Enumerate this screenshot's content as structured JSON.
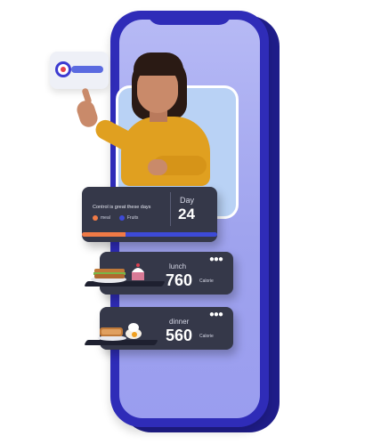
{
  "day_card": {
    "caption": "Control is great these days",
    "legend": [
      {
        "label": "meal",
        "color": "#f07a46"
      },
      {
        "label": "Fruits",
        "color": "#3d4ad6"
      }
    ],
    "day_label": "Day",
    "day_number": "24",
    "progress_meal_fraction": 0.32
  },
  "lunch": {
    "label": "lunch",
    "calories": "760",
    "unit": "Calorie"
  },
  "dinner": {
    "label": "dinner",
    "calories": "560",
    "unit": "Calorie"
  },
  "icons": {
    "more": "more-dots-icon",
    "toggle": "toggle-switch-icon"
  },
  "colors": {
    "phone": "#2f2cb8",
    "screen": "#b6b9f5",
    "card": "#353849",
    "accent_orange": "#f07a46",
    "accent_blue": "#3d4ad6"
  }
}
